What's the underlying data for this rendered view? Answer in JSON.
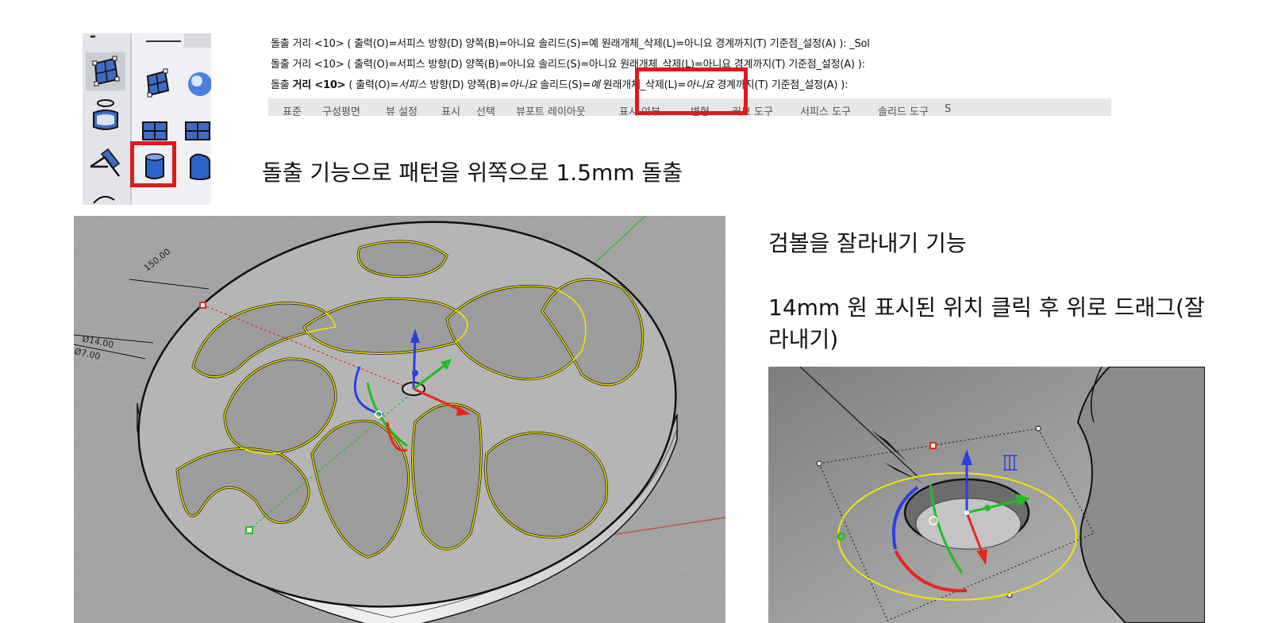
{
  "command_lines": [
    {
      "parts": [
        {
          "text": "돌출 거리 <10> ( 출력(O)=서피스  방향(D)  양쪽(B)=아니요  솔리드(S)=예  원래개체_삭제(L)=아니요  경계까지(T)  기준점_설정(A) ): _Sol",
          "style": "normal"
        }
      ]
    },
    {
      "parts": [
        {
          "text": "돌출 거리 <10> ( 출력(O)=서피스  방향(D)  양쪽(B)=아니요  솔리드(S)=아니요  원래개체_삭제(L)=아니요  경계까지(T)  기준점_설정(A) ):",
          "style": "normal"
        }
      ]
    },
    {
      "parts": [
        {
          "text": "돌출 ",
          "style": "normal"
        },
        {
          "text": "거리 <10>",
          "style": "bold"
        },
        {
          "text": " ( 출력(O)=",
          "style": "normal"
        },
        {
          "text": "서피스",
          "style": "italic"
        },
        {
          "text": "  방향(D)  양쪽(B)=",
          "style": "normal"
        },
        {
          "text": "아니요",
          "style": "italic"
        },
        {
          "text": "  솔리드(S)=",
          "style": "normal"
        },
        {
          "text": "예",
          "style": "italic"
        },
        {
          "text": "  원래개체_삭제(L)=",
          "style": "normal"
        },
        {
          "text": "아니요",
          "style": "italic"
        },
        {
          "text": "  경계까지(T)  기준점_설정(A) ):",
          "style": "normal"
        }
      ]
    }
  ],
  "tabs": [
    "표준",
    "구성평면",
    "뷰 설정",
    "표시",
    "선택",
    "뷰포트 레이아웃",
    "표시 여부",
    "변형",
    "커브 도구",
    "서피스 도구",
    "솔리드 도구",
    "S"
  ],
  "captions": {
    "extrude": "돌출 기능으로  패턴을 위쪽으로 1.5mm 돌출",
    "trim": "검볼을 잘라내기 기능",
    "instruction": "14mm 원 표시된 위치 클릭 후 위로 드래그(잘라내기)"
  },
  "viewport1": {
    "dimension_labels": [
      "150.00",
      "Ø14.00",
      "Ø7.00"
    ]
  },
  "colors": {
    "highlight": "#e0191c",
    "curve": "#f2e600",
    "gumball_x": "#e8261e",
    "gumball_y": "#1fbf1f",
    "gumball_z": "#2b3fe0"
  },
  "icons": [
    "surface-from-points-icon",
    "surface-from-points-icon",
    "sphere-icon",
    "cylinder-surface-icon",
    "plane-grid-icon",
    "plane-grid-icon",
    "extrude-solid-icon",
    "extrude-solid-alt-icon",
    "cut-plane-icon"
  ]
}
